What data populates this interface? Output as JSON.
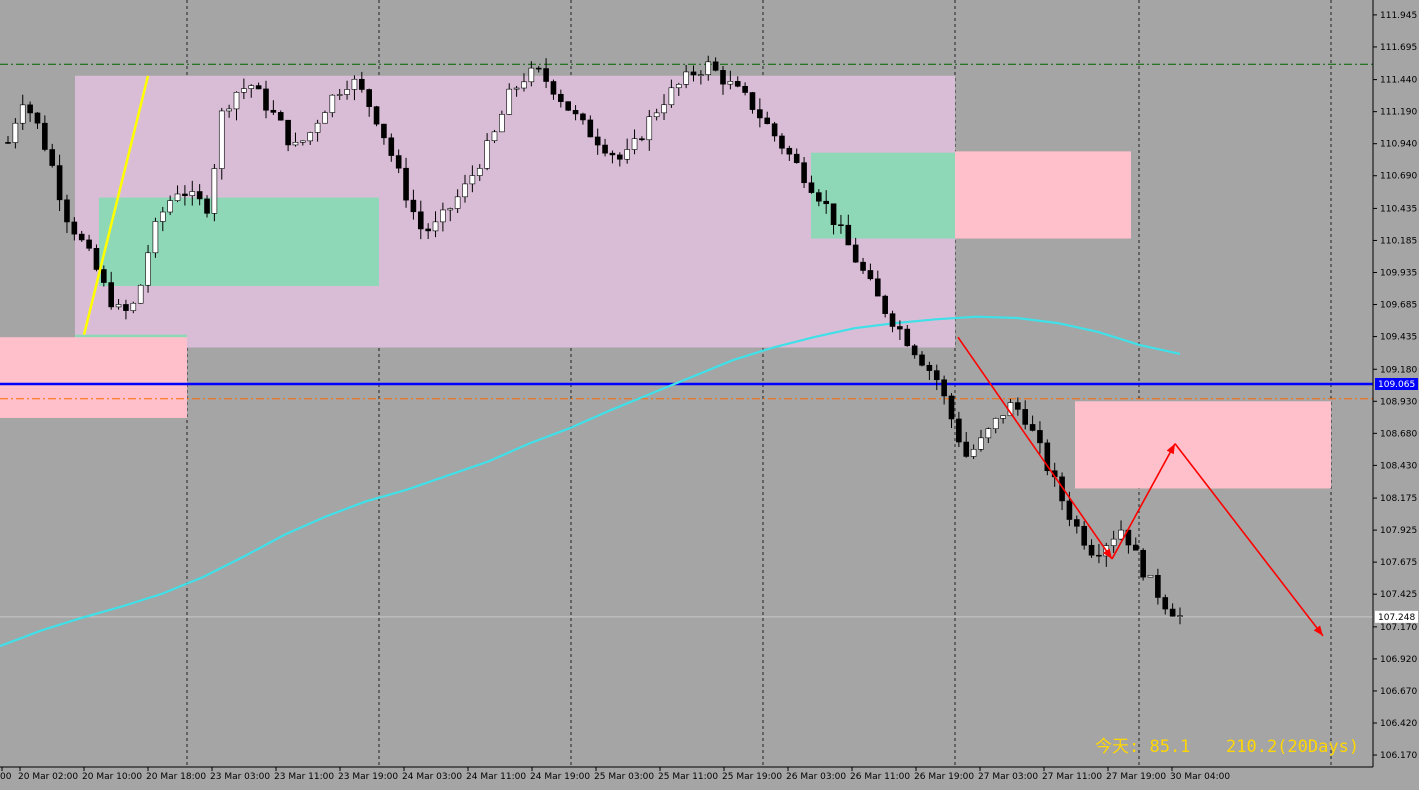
{
  "platform": "MetaTrader chart",
  "colors": {
    "background": "#a5a5a5",
    "bull_candle": "#ffffff",
    "bear_candle": "#000000",
    "wick": "#000000",
    "zone_purple": "#d9bdd6",
    "zone_green": "#8ed8b8",
    "zone_pink": "#ffc0cb",
    "ma_line": "#40e0e8",
    "support_line": "#0000ff",
    "projection_arrows": "#ff0000",
    "impulse_line": "#ffff00",
    "info_text": "#ffd700",
    "dashdot_top": "#006400",
    "dashdot_mid": "#ff6a00"
  },
  "y_axis": {
    "ticks": [
      "111.945",
      "111.695",
      "111.440",
      "111.190",
      "110.940",
      "110.690",
      "110.435",
      "110.185",
      "109.935",
      "109.685",
      "109.435",
      "109.180",
      "108.930",
      "108.680",
      "108.430",
      "108.175",
      "107.925",
      "107.675",
      "107.425",
      "107.170",
      "106.920",
      "106.670",
      "106.420",
      "106.170"
    ]
  },
  "price_labels": {
    "support": "109.065",
    "current": "107.248"
  },
  "x_axis": {
    "labels": [
      "00",
      "20 Mar 02:00",
      "20 Mar 10:00",
      "20 Mar 18:00",
      "23 Mar 03:00",
      "23 Mar 11:00",
      "23 Mar 19:00",
      "24 Mar 03:00",
      "24 Mar 11:00",
      "24 Mar 19:00",
      "25 Mar 03:00",
      "25 Mar 11:00",
      "25 Mar 19:00",
      "26 Mar 03:00",
      "26 Mar 11:00",
      "26 Mar 19:00",
      "27 Mar 03:00",
      "27 Mar 11:00",
      "27 Mar 19:00",
      "30 Mar 04:00"
    ]
  },
  "info": {
    "today": "今天: 85.1",
    "days20": "210.2(20Days)"
  },
  "chart_data": {
    "type": "candlestick",
    "symbol_timeframe": "",
    "x": [
      "20 Mar 02:00",
      "20 Mar 10:00",
      "20 Mar 18:00",
      "23 Mar 03:00",
      "23 Mar 11:00",
      "23 Mar 19:00",
      "24 Mar 03:00",
      "24 Mar 11:00",
      "24 Mar 19:00",
      "25 Mar 03:00",
      "25 Mar 11:00",
      "25 Mar 19:00",
      "26 Mar 03:00",
      "26 Mar 11:00",
      "26 Mar 19:00",
      "27 Mar 03:00",
      "27 Mar 11:00",
      "27 Mar 19:00",
      "30 Mar 04:00"
    ],
    "close_path": [
      110.95,
      111.3,
      111.1,
      110.8,
      110.4,
      110.2,
      110.0,
      109.75,
      109.6,
      109.7,
      110.2,
      110.45,
      110.6,
      110.5,
      110.45,
      111.2,
      111.35,
      111.4,
      111.25,
      111.1,
      110.9,
      111.0,
      111.2,
      111.35,
      111.45,
      111.3,
      111.1,
      110.8,
      110.5,
      110.25,
      110.3,
      110.45,
      110.6,
      110.8,
      111.0,
      111.3,
      111.45,
      111.5,
      111.4,
      111.25,
      111.1,
      111.0,
      110.9,
      110.8,
      110.95,
      111.15,
      111.3,
      111.4,
      111.5,
      111.55,
      111.45,
      111.35,
      111.25,
      111.1,
      110.95,
      110.8,
      110.65,
      110.5,
      110.3,
      110.1,
      109.9,
      109.7,
      109.55,
      109.4,
      109.25,
      109.1,
      108.8,
      108.5,
      108.6,
      108.75,
      108.9,
      108.85,
      108.6,
      108.35,
      108.1,
      107.9,
      107.75,
      107.85,
      107.95,
      107.7,
      107.5,
      107.35,
      107.25
    ],
    "moving_average": [
      107.02,
      107.14,
      107.24,
      107.33,
      107.43,
      107.56,
      107.72,
      107.89,
      108.03,
      108.15,
      108.24,
      108.35,
      108.46,
      108.6,
      108.72,
      108.86,
      108.99,
      109.12,
      109.25,
      109.35,
      109.43,
      109.5,
      109.54,
      109.57,
      109.59,
      109.58,
      109.54,
      109.47,
      109.37,
      109.3
    ],
    "zones": [
      {
        "kind": "purple",
        "from": 111.47,
        "to": 109.35
      },
      {
        "kind": "green",
        "from": 110.52,
        "to": 109.83
      },
      {
        "kind": "green",
        "from": 110.87,
        "to": 110.2
      },
      {
        "kind": "green",
        "from": 109.45,
        "to": 109.35
      },
      {
        "kind": "pink",
        "from": 110.88,
        "to": 110.2
      },
      {
        "kind": "pink",
        "from": 109.43,
        "to": 108.8
      },
      {
        "kind": "pink",
        "from": 108.93,
        "to": 108.25
      }
    ],
    "horizontal_levels": [
      {
        "kind": "support",
        "value": 109.065
      },
      {
        "kind": "dashdot_top",
        "value": 111.56
      },
      {
        "kind": "dashdot_mid",
        "value": 108.95
      },
      {
        "kind": "current",
        "value": 107.248
      }
    ],
    "projection_path": [
      109.43,
      107.7,
      108.6,
      107.1
    ],
    "ylim": [
      106.1,
      112.03
    ],
    "grid": true
  }
}
